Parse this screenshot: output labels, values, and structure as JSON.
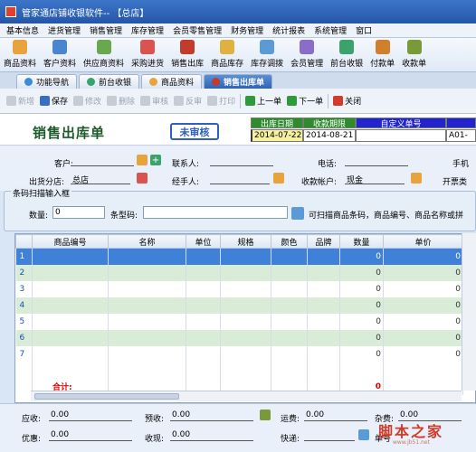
{
  "window": {
    "title": "管家通店铺收银软件-- 【总店】"
  },
  "menu": [
    "基本信息",
    "进货管理",
    "销售管理",
    "库存管理",
    "会员零售管理",
    "财务管理",
    "统计报表",
    "系统管理",
    "窗口"
  ],
  "toolbar": [
    {
      "label": "商品资料",
      "icon": "goods-icon",
      "color": "#e8a33c"
    },
    {
      "label": "客户资料",
      "icon": "customer-icon",
      "color": "#4a86d0"
    },
    {
      "label": "供应商资料",
      "icon": "supplier-icon",
      "color": "#6aa84f"
    },
    {
      "label": "采购进货",
      "icon": "purchase-icon",
      "color": "#d9534f"
    },
    {
      "label": "销售出库",
      "icon": "sales-icon",
      "color": "#c23b2c"
    },
    {
      "label": "商品库存",
      "icon": "stock-icon",
      "color": "#e0b040"
    },
    {
      "label": "库存调拨",
      "icon": "transfer-icon",
      "color": "#5b9bd5"
    },
    {
      "label": "会员管理",
      "icon": "member-icon",
      "color": "#8a6dc8"
    },
    {
      "label": "前台收银",
      "icon": "cashier-icon",
      "color": "#3aa36b"
    },
    {
      "label": "付款单",
      "icon": "payment-icon",
      "color": "#d07f2c"
    },
    {
      "label": "收款单",
      "icon": "receipt-icon",
      "color": "#7a9a3a"
    }
  ],
  "tabs": [
    {
      "label": "功能导航",
      "icon": "navigation-icon",
      "color": "#3a8ad8"
    },
    {
      "label": "前台收银",
      "icon": "cashier-tab-icon",
      "color": "#3aa36b"
    },
    {
      "label": "商品资料",
      "icon": "goods-tab-icon",
      "color": "#e8a33c"
    },
    {
      "label": "销售出库单",
      "icon": "sales-tab-icon",
      "color": "#c23b2c"
    }
  ],
  "actions": [
    {
      "label": "新增",
      "icon": "new-icon",
      "enabled": false
    },
    {
      "label": "保存",
      "icon": "save-icon",
      "enabled": true,
      "color": "#3a6fc0"
    },
    {
      "label": "修改",
      "icon": "edit-icon",
      "enabled": false
    },
    {
      "label": "删除",
      "icon": "delete-icon",
      "enabled": false
    },
    {
      "label": "审核",
      "icon": "approve-icon",
      "enabled": false
    },
    {
      "label": "反审",
      "icon": "unapprove-icon",
      "enabled": false
    },
    {
      "label": "打印",
      "icon": "print-icon",
      "enabled": false
    },
    {
      "label": "上一单",
      "icon": "prev-icon",
      "enabled": true,
      "color": "#2f9a3a"
    },
    {
      "label": "下一单",
      "icon": "next-icon",
      "enabled": true,
      "color": "#2f9a3a"
    },
    {
      "label": "关闭",
      "icon": "close-icon",
      "enabled": true,
      "color": "#d23a2a"
    }
  ],
  "doc": {
    "title": "销售出库单",
    "status": "未审核",
    "date_header": "出库日期",
    "date_value": "2014-07-22",
    "due_header": "收款期限",
    "due_value": "2014-08-21",
    "custom_header": "自定义单号",
    "custom_value": "",
    "doc_no_value": "A01-"
  },
  "form": {
    "customer_label": "客户:",
    "customer_value": "",
    "contact_label": "联系人:",
    "contact_value": "",
    "phone_label": "电话:",
    "phone_value": "",
    "mobile_label": "手机",
    "branch_label": "出货分店:",
    "branch_value": "总店",
    "handler_label": "经手人:",
    "handler_value": "",
    "account_label": "收款帐户:",
    "account_value": "现金",
    "invoice_label": "开票类"
  },
  "scan": {
    "legend": "条码扫描输入框",
    "qty_label": "数量:",
    "qty_value": "0",
    "barcode_label": "条型码:",
    "barcode_value": "",
    "hint": "可扫描商品条码，商品编号、商品名称或拼"
  },
  "grid": {
    "columns": [
      "商品编号",
      "名称",
      "单位",
      "规格",
      "颜色",
      "品牌",
      "数量",
      "单价"
    ],
    "rows": [
      {
        "n": "1",
        "qty": "0",
        "price": "0"
      },
      {
        "n": "2",
        "qty": "0",
        "price": "0"
      },
      {
        "n": "3",
        "qty": "0",
        "price": "0"
      },
      {
        "n": "4",
        "qty": "0",
        "price": "0"
      },
      {
        "n": "5",
        "qty": "0",
        "price": "0"
      },
      {
        "n": "6",
        "qty": "0",
        "price": "0"
      },
      {
        "n": "7",
        "qty": "0",
        "price": "0"
      }
    ],
    "total_label": "合计:",
    "total_qty": "0"
  },
  "footer": {
    "receivable_label": "应收:",
    "receivable_value": "0.00",
    "prepaid_label": "预收:",
    "prepaid_value": "0.00",
    "freight_label": "运费:",
    "freight_value": "0.00",
    "misc_label": "杂费:",
    "misc_value": "0.00",
    "discount_label": "优惠:",
    "discount_value": "0.00",
    "received_label": "收现:",
    "received_value": "0.00",
    "express_label": "快递:",
    "express_value": "",
    "tracking_label": "单号"
  },
  "watermark": {
    "text": "脚本之家",
    "sub": "www.jb51.net"
  }
}
